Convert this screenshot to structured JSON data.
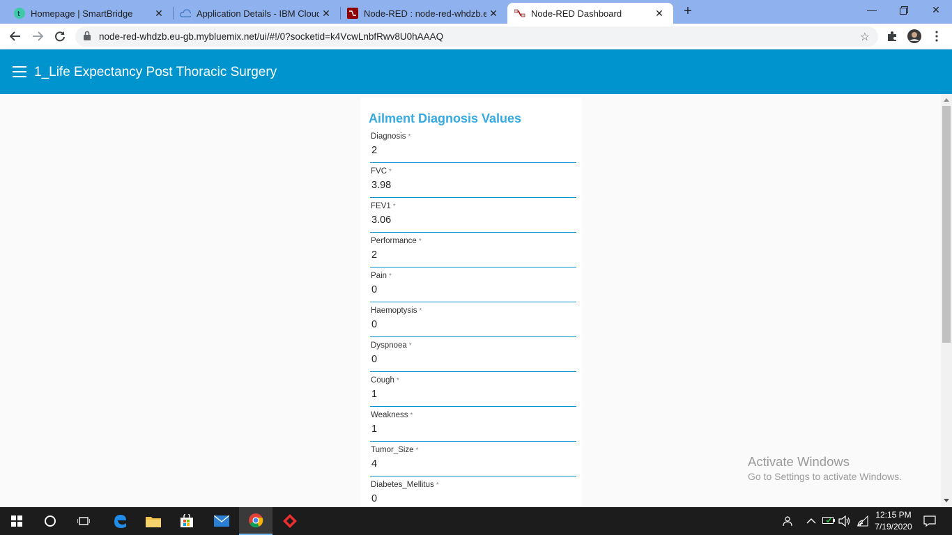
{
  "browser": {
    "tabs": [
      {
        "title": "Homepage | SmartBridge",
        "active": false
      },
      {
        "title": "Application Details - IBM Cloud",
        "active": false
      },
      {
        "title": "Node-RED : node-red-whdzb.eu-",
        "active": false
      },
      {
        "title": "Node-RED Dashboard",
        "active": true
      }
    ],
    "url": "node-red-whdzb.eu-gb.mybluemix.net/ui/#!/0?socketid=k4VcwLnbfRwv8U0hAAAQ"
  },
  "dashboard": {
    "page_title": "1_Life Expectancy Post Thoracic Surgery",
    "header_color": "#0094ce",
    "group_title": "Ailment Diagnosis Values",
    "required_marker": "*",
    "fields": [
      {
        "label": "Diagnosis",
        "value": "2"
      },
      {
        "label": "FVC",
        "value": "3.98"
      },
      {
        "label": "FEV1",
        "value": "3.06"
      },
      {
        "label": "Performance",
        "value": "2"
      },
      {
        "label": "Pain",
        "value": "0"
      },
      {
        "label": "Haemoptysis",
        "value": "0"
      },
      {
        "label": "Dyspnoea",
        "value": "0"
      },
      {
        "label": "Cough",
        "value": "1"
      },
      {
        "label": "Weakness",
        "value": "1"
      },
      {
        "label": "Tumor_Size",
        "value": "4"
      },
      {
        "label": "Diabetes_Mellitus",
        "value": "0"
      }
    ]
  },
  "watermark": {
    "line1": "Activate Windows",
    "line2": "Go to Settings to activate Windows."
  },
  "taskbar": {
    "time": "12:15 PM",
    "date": "7/19/2020"
  }
}
